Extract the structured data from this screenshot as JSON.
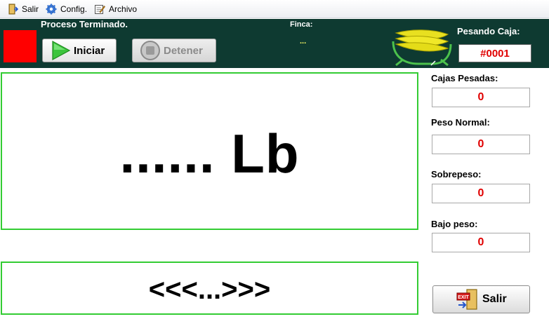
{
  "menu": {
    "items": [
      {
        "label": "Salir",
        "icon": "exit-door-icon"
      },
      {
        "label": "Config.",
        "icon": "gear-icon"
      },
      {
        "label": "Archivo",
        "icon": "edit-file-icon"
      }
    ]
  },
  "header": {
    "status_indicator_color": "#ff0000",
    "process_status": "Proceso Terminado.",
    "start_label": "Iniciar",
    "stop_label": "Detener",
    "farm_label": "Finca:",
    "farm_value": "...",
    "box_label": "Pesando Caja:",
    "box_number": "#0001",
    "logo_icon": "banana-scale-logo"
  },
  "weight": {
    "value": "...... Lb"
  },
  "direction": {
    "value": "<<<...>>>"
  },
  "stats": {
    "boxes_weighed_label": "Cajas Pesadas:",
    "boxes_weighed_value": "0",
    "normal_weight_label": "Peso Normal:",
    "normal_weight_value": "0",
    "overweight_label": "Sobrepeso:",
    "overweight_value": "0",
    "underweight_label": "Bajo peso:",
    "underweight_value": "0"
  },
  "exit_button": {
    "label": "Salir",
    "icon": "exit-sign-icon"
  },
  "colors": {
    "header_bg": "#0e3a31",
    "panel_border": "#33cc33",
    "value_red": "#e00000"
  }
}
